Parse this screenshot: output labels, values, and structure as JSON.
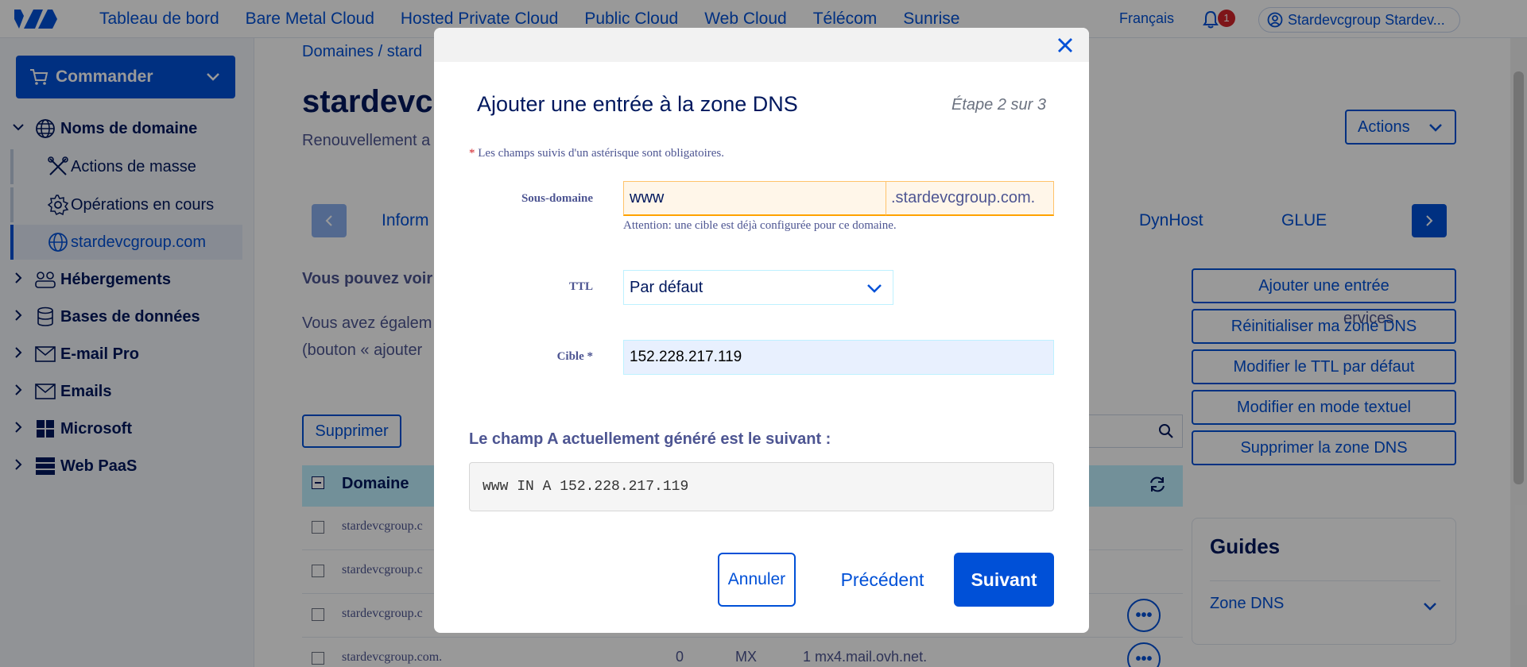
{
  "topnav": {
    "items": [
      "Tableau de bord",
      "Bare Metal Cloud",
      "Hosted Private Cloud",
      "Public Cloud",
      "Web Cloud",
      "Télécom",
      "Sunrise"
    ],
    "language": "Français",
    "notifications_count": "1",
    "account": "Stardevcgroup Stardev..."
  },
  "sidebar": {
    "order_button": "Commander",
    "domains": "Noms de domaine",
    "bulk_actions": "Actions de masse",
    "operations": "Opérations en cours",
    "current_domain": "stardevcgroup.com",
    "hosting": "Hébergements",
    "databases": "Bases de données",
    "email_pro": "E-mail Pro",
    "emails": "Emails",
    "microsoft": "Microsoft",
    "web_paas": "Web PaaS"
  },
  "main": {
    "breadcrumb": "Domaines / stard",
    "title": "stardevcg",
    "subtitle": "Renouvellement a",
    "actions_button": "Actions",
    "tabs": {
      "info": "Inform",
      "dynhost": "DynHost",
      "glue": "GLUE"
    },
    "intro_bold": "Vous pouvez voir",
    "intro_line1": "Vous avez égalem",
    "intro_line1_end": "ervices",
    "intro_line2": "(bouton « ajouter",
    "right_buttons": [
      "Ajouter une entrée",
      "Réinitialiser ma zone DNS",
      "Modifier le TTL par défaut",
      "Modifier en mode textuel",
      "Supprimer la zone DNS"
    ],
    "delete_button": "Supprimer",
    "table": {
      "header_domain": "Domaine",
      "rows": [
        {
          "domain": "stardevcgroup.c",
          "ttl": "",
          "type": "",
          "target": ""
        },
        {
          "domain": "stardevcgroup.c",
          "ttl": "",
          "type": "",
          "target": ""
        },
        {
          "domain": "stardevcgroup.c",
          "ttl": "",
          "type": "",
          "target": ""
        },
        {
          "domain": "stardevcgroup.com.",
          "ttl": "0",
          "type": "MX",
          "target": "1 mx4.mail.ovh.net."
        }
      ]
    },
    "guides": {
      "title": "Guides",
      "link": "Zone DNS"
    }
  },
  "modal": {
    "title": "Ajouter une entrée à la zone DNS",
    "step": "Étape 2 sur 3",
    "required_star": "*",
    "required_note": "Les champs suivis d'un astérisque sont obligatoires.",
    "subdomain_label": "Sous-domaine",
    "subdomain_value": "www",
    "subdomain_suffix": ".stardevcgroup.com.",
    "subdomain_warning": "Attention: une cible est déjà configurée pour ce domaine.",
    "ttl_label": "TTL",
    "ttl_value": "Par défaut",
    "target_label": "Cible  *",
    "target_value": "152.228.217.119",
    "generated_label": "Le champ A actuellement généré est le suivant :",
    "generated_value": "www IN A 152.228.217.119",
    "cancel": "Annuler",
    "previous": "Précédent",
    "next": "Suivant"
  }
}
